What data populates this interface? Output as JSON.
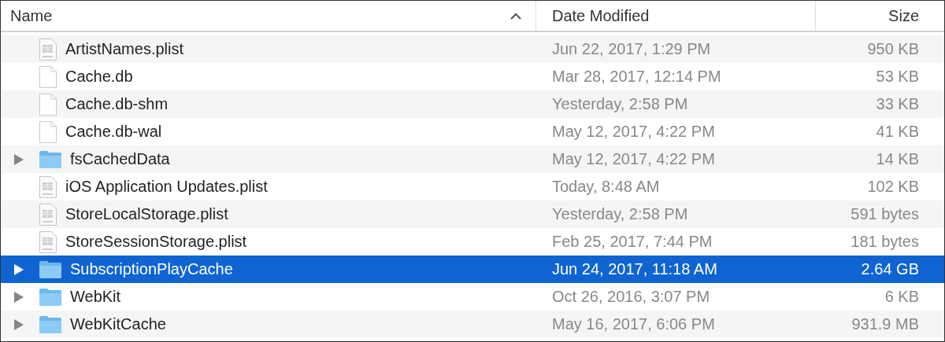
{
  "columns": [
    {
      "label": "Name",
      "sorted": true
    },
    {
      "label": "Date Modified",
      "sorted": false
    },
    {
      "label": "Size",
      "sorted": false
    }
  ],
  "rows": [
    {
      "kind": "plist",
      "name": "ArtistNames.plist",
      "date": "Jun 22, 2017, 1:29 PM",
      "size": "950 KB",
      "selected": false
    },
    {
      "kind": "document",
      "name": "Cache.db",
      "date": "Mar 28, 2017, 12:14 PM",
      "size": "53 KB",
      "selected": false
    },
    {
      "kind": "document",
      "name": "Cache.db-shm",
      "date": "Yesterday, 2:58 PM",
      "size": "33 KB",
      "selected": false
    },
    {
      "kind": "document",
      "name": "Cache.db-wal",
      "date": "May 12, 2017, 4:22 PM",
      "size": "41 KB",
      "selected": false
    },
    {
      "kind": "folder",
      "name": "fsCachedData",
      "date": "May 12, 2017, 4:22 PM",
      "size": "14 KB",
      "selected": false,
      "expanded": false
    },
    {
      "kind": "plist",
      "name": "iOS Application Updates.plist",
      "date": "Today, 8:48 AM",
      "size": "102 KB",
      "selected": false
    },
    {
      "kind": "plist",
      "name": "StoreLocalStorage.plist",
      "date": "Yesterday, 2:58 PM",
      "size": "591 bytes",
      "selected": false
    },
    {
      "kind": "plist",
      "name": "StoreSessionStorage.plist",
      "date": "Feb 25, 2017, 7:44 PM",
      "size": "181 bytes",
      "selected": false
    },
    {
      "kind": "folder",
      "name": "SubscriptionPlayCache",
      "date": "Jun 24, 2017, 11:18 AM",
      "size": "2.64 GB",
      "selected": true,
      "expanded": false
    },
    {
      "kind": "folder",
      "name": "WebKit",
      "date": "Oct 26, 2016, 3:07 PM",
      "size": "6 KB",
      "selected": false,
      "expanded": false
    },
    {
      "kind": "folder",
      "name": "WebKitCache",
      "date": "May 16, 2017, 6:06 PM",
      "size": "931.9 MB",
      "selected": false,
      "expanded": false
    }
  ]
}
